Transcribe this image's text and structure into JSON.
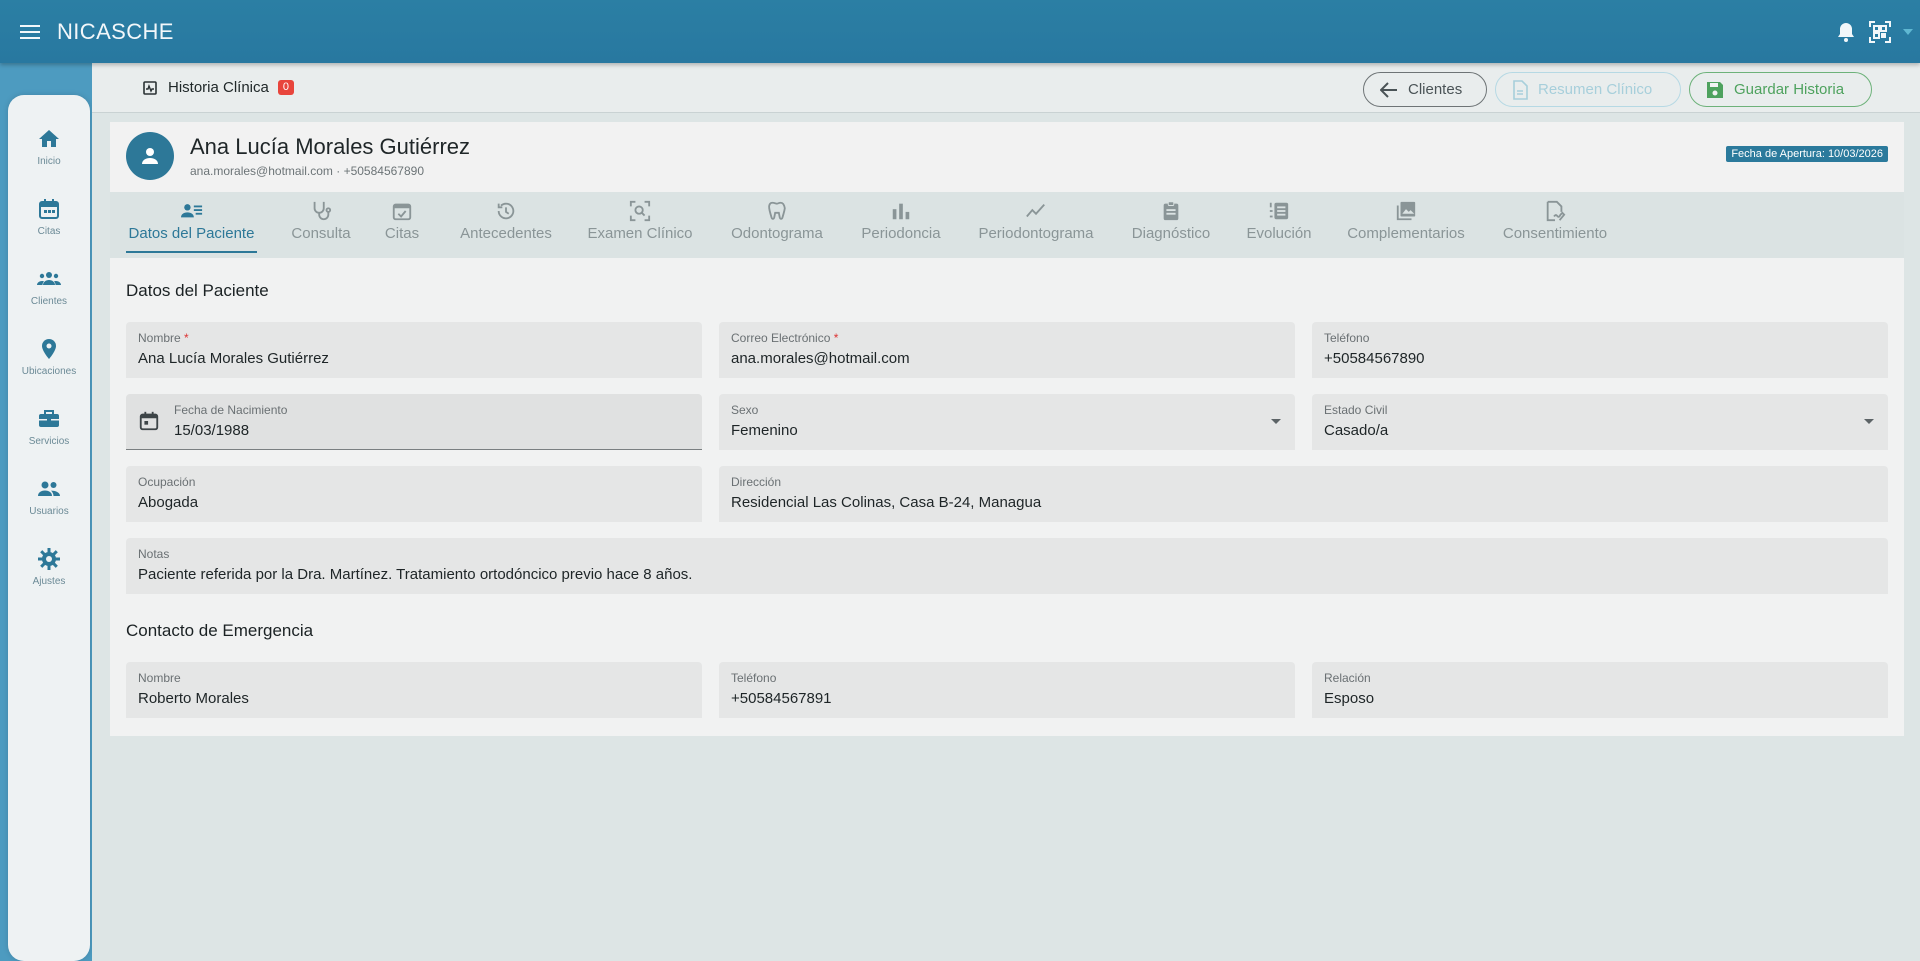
{
  "app": {
    "title": "NICASCHE"
  },
  "sidebar": {
    "items": [
      {
        "label": "Inicio",
        "icon": "home-icon"
      },
      {
        "label": "Citas",
        "icon": "calendar-icon"
      },
      {
        "label": "Clientes",
        "icon": "groups-icon"
      },
      {
        "label": "Ubicaciones",
        "icon": "location-pin-icon"
      },
      {
        "label": "Servicios",
        "icon": "briefcase-icon"
      },
      {
        "label": "Usuarios",
        "icon": "people-icon"
      },
      {
        "label": "Ajustes",
        "icon": "gear-icon"
      }
    ]
  },
  "subheader": {
    "title": "Historia Clínica",
    "count": "0",
    "back_label": "Clientes",
    "summary_label": "Resumen Clínico",
    "save_label": "Guardar Historia"
  },
  "patient": {
    "name": "Ana Lucía Morales Gutiérrez",
    "contact": "ana.morales@hotmail.com · +50584567890",
    "opening_date": "Fecha de Apertura: 10/03/2026"
  },
  "tabs": [
    {
      "label": "Datos del Paciente",
      "icon": "person-list-icon",
      "active": true
    },
    {
      "label": "Consulta",
      "icon": "stethoscope-icon"
    },
    {
      "label": "Citas",
      "icon": "calendar-check-icon"
    },
    {
      "label": "Antecedentes",
      "icon": "history-icon"
    },
    {
      "label": "Examen Clínico",
      "icon": "scan-search-icon"
    },
    {
      "label": "Odontograma",
      "icon": "tooth-icon"
    },
    {
      "label": "Periodoncia",
      "icon": "bar-chart-icon"
    },
    {
      "label": "Periodontograma",
      "icon": "line-chart-icon"
    },
    {
      "label": "Diagnóstico",
      "icon": "clipboard-icon"
    },
    {
      "label": "Evolución",
      "icon": "list-numbered-icon"
    },
    {
      "label": "Complementarios",
      "icon": "photo-library-icon"
    },
    {
      "label": "Consentimiento",
      "icon": "signature-icon"
    }
  ],
  "datos": {
    "section_title": "Datos del Paciente",
    "nombre": {
      "label": "Nombre",
      "value": "Ana Lucía Morales Gutiérrez"
    },
    "correo": {
      "label": "Correo Electrónico",
      "value": "ana.morales@hotmail.com"
    },
    "telefono": {
      "label": "Teléfono",
      "value": "+50584567890"
    },
    "nacimiento": {
      "label": "Fecha de Nacimiento",
      "value": "15/03/1988"
    },
    "sexo": {
      "label": "Sexo",
      "value": "Femenino"
    },
    "estado_civil": {
      "label": "Estado Civil",
      "value": "Casado/a"
    },
    "ocupacion": {
      "label": "Ocupación",
      "value": "Abogada"
    },
    "direccion": {
      "label": "Dirección",
      "value": "Residencial Las Colinas, Casa B-24, Managua"
    },
    "notas": {
      "label": "Notas",
      "value": "Paciente referida por la Dra. Martínez. Tratamiento ortodóncico previo hace 8 años."
    }
  },
  "emergencia": {
    "section_title": "Contacto de Emergencia",
    "nombre": {
      "label": "Nombre",
      "value": "Roberto Morales"
    },
    "telefono": {
      "label": "Teléfono",
      "value": "+50584567891"
    },
    "relacion": {
      "label": "Relación",
      "value": "Esposo"
    }
  },
  "colors": {
    "primary": "#2d7898",
    "topbar": "#2b7fa4",
    "badge": "#e8453c",
    "save": "#4ea25e"
  }
}
